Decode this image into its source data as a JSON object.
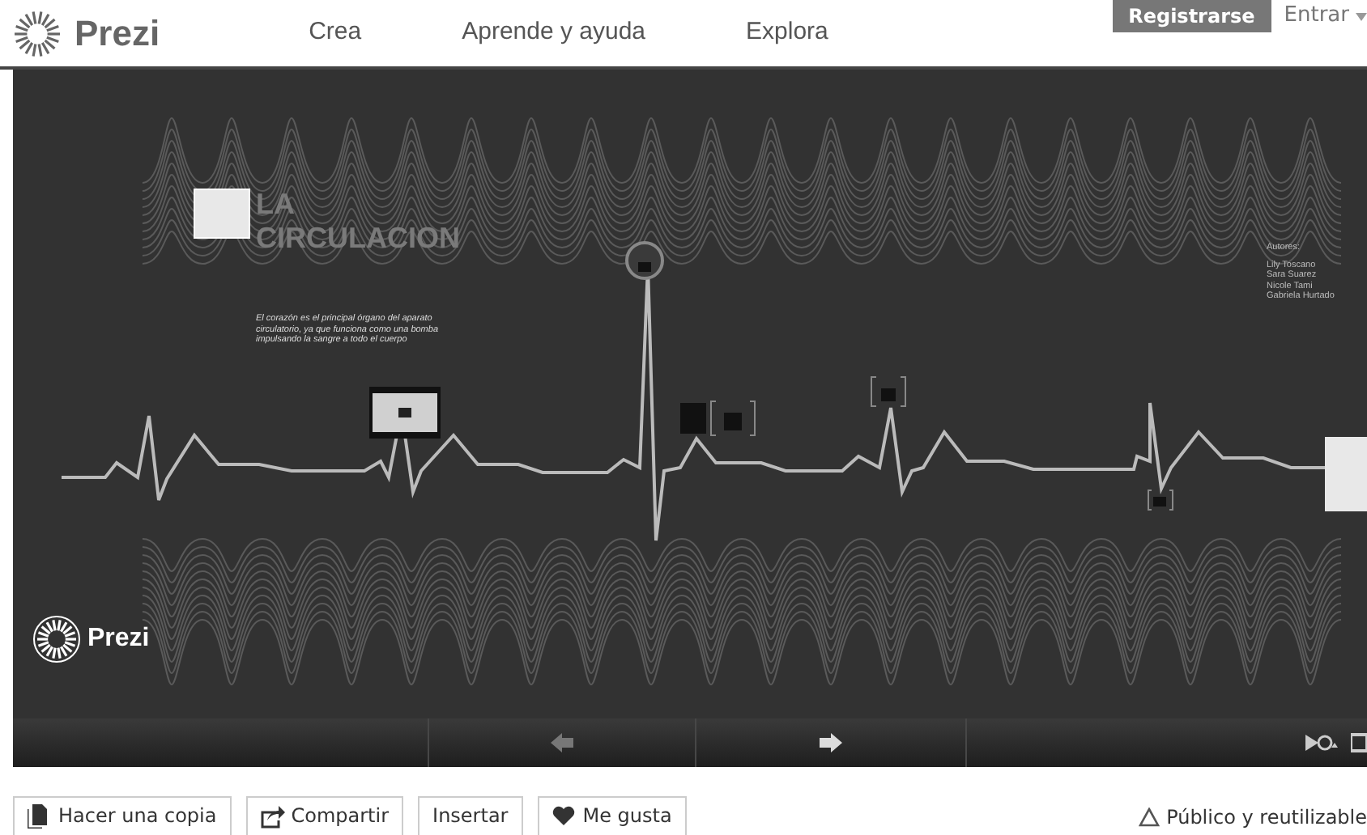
{
  "nav": {
    "logo": "Prezi",
    "links": [
      {
        "label": "Crea"
      },
      {
        "label": "Aprende y ayuda"
      },
      {
        "label": "Explora"
      }
    ],
    "register": "Registrarse",
    "login": "Entrar"
  },
  "presentation": {
    "title_lines": [
      "LA",
      "CIRCULACION"
    ],
    "description": "El corazón es el principal órgano del aparato circulatorio, ya que funciona como una bomba impulsando la sangre a todo el cuerpo",
    "authors_heading": "Autores:",
    "authors": [
      "Lily Toscano",
      "Sara Suarez",
      "Nicole Tami",
      "Gabriela Hurtado"
    ],
    "brand": "Prezi"
  },
  "actions": [
    {
      "label": "Hacer una copia",
      "kind": "copy"
    },
    {
      "label": "Compartir",
      "kind": "share"
    },
    {
      "label": "Insertar",
      "kind": "plain"
    },
    {
      "label": "Me gusta",
      "kind": "like"
    }
  ],
  "license": "Público y reutilizable"
}
